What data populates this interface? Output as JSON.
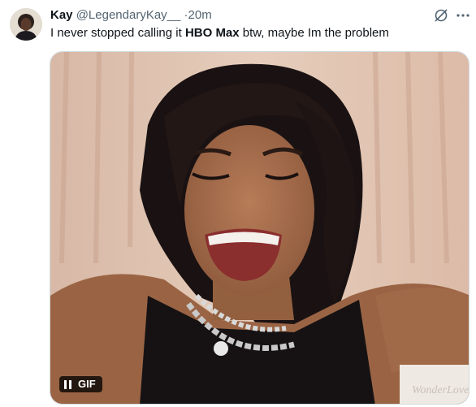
{
  "tweet": {
    "author_name": "Kay",
    "author_handle": "@LegendaryKay__",
    "separator": "·",
    "time": "20m",
    "text_before": "I never stopped calling it ",
    "text_bold": "HBO Max",
    "text_after": " btw, maybe Im the problem"
  },
  "media": {
    "badge_label": "GIF",
    "watermark": "WonderLove"
  },
  "icons": {
    "grok": "grok-icon",
    "more": "more-icon",
    "pause": "pause-icon"
  },
  "colors": {
    "text": "#0f1419",
    "secondary_text": "#536471",
    "border": "#cfd9de"
  }
}
